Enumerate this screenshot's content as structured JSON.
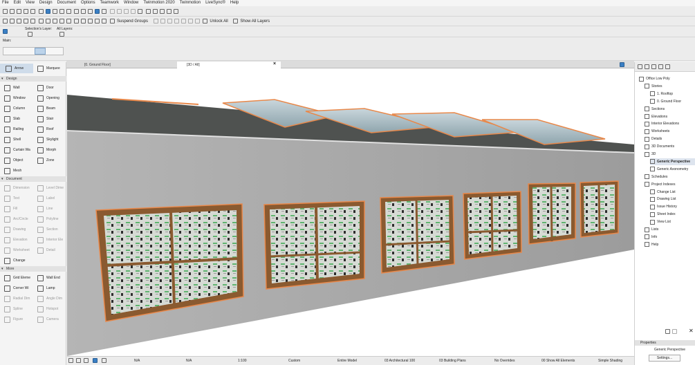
{
  "menu": [
    "File",
    "Edit",
    "View",
    "Design",
    "Document",
    "Options",
    "Teamwork",
    "Window",
    "Twinmotion 2020",
    "Twinmotion",
    "LiveSync®",
    "Help"
  ],
  "toolbar": {
    "suspend_groups": "Suspend Groups",
    "unlock_all": "Unlock All",
    "show_all_layers": "Show All Layers"
  },
  "infobox": {
    "selection_layer": "Selection's Layer:",
    "all_layers": "All Layers:",
    "main_label": "Main:"
  },
  "tabs": [
    {
      "label": "[0. Ground Floor]"
    },
    {
      "label": "[3D / All]"
    }
  ],
  "toolbox": {
    "arrow": "Arrow",
    "marquee": "Marquee",
    "sections": {
      "design": "Design",
      "document": "Document",
      "more": "More"
    },
    "design_tools": [
      "Wall",
      "Door",
      "Window",
      "Opening",
      "Column",
      "Beam",
      "Slab",
      "Stair",
      "Railing",
      "Roof",
      "Shell",
      "Skylight",
      "Curtain Wa",
      "Morph",
      "Object",
      "Zone",
      "Mesh"
    ],
    "document_tools": [
      "Dimension",
      "Level Dime",
      "Text",
      "Label",
      "Fill",
      "Line",
      "Arc/Circle",
      "Polyline",
      "Drawing",
      "Section",
      "Elevation",
      "Interior Ele",
      "Worksheet",
      "Detail",
      "Change"
    ],
    "more_tools": [
      "Grid Eleme",
      "Wall End",
      "Corner Wi",
      "Lamp",
      "Radial Dim",
      "Angle Dim",
      "Spline",
      "Hotspot",
      "Figure",
      "Camera"
    ]
  },
  "navigator": {
    "items": [
      {
        "label": "Office Low Poly",
        "level": 0
      },
      {
        "label": "Stories",
        "level": 1
      },
      {
        "label": "1. Rooftop",
        "level": 2
      },
      {
        "label": "0. Ground Floor",
        "level": 2
      },
      {
        "label": "Sections",
        "level": 1
      },
      {
        "label": "Elevations",
        "level": 1
      },
      {
        "label": "Interior Elevations",
        "level": 1
      },
      {
        "label": "Worksheets",
        "level": 1
      },
      {
        "label": "Details",
        "level": 1
      },
      {
        "label": "3D Documents",
        "level": 1
      },
      {
        "label": "3D",
        "level": 1
      },
      {
        "label": "Generic Perspective",
        "level": 2,
        "selected": true
      },
      {
        "label": "Generic Axonometry",
        "level": 2
      },
      {
        "label": "Schedules",
        "level": 1
      },
      {
        "label": "Project Indexes",
        "level": 1
      },
      {
        "label": "Change List",
        "level": 2
      },
      {
        "label": "Drawing List",
        "level": 2
      },
      {
        "label": "Issue History",
        "level": 2
      },
      {
        "label": "Sheet Index",
        "level": 2
      },
      {
        "label": "View List",
        "level": 2
      },
      {
        "label": "Lists",
        "level": 1
      },
      {
        "label": "Info",
        "level": 1
      },
      {
        "label": "Help",
        "level": 1
      }
    ],
    "properties_label": "Properties",
    "properties_value": "Generic Perspective",
    "settings_button": "Settings..."
  },
  "statusbar": {
    "na1": "N/A",
    "na2": "N/A",
    "scale": "1:100",
    "custom": "Custom",
    "model": "Entire Model",
    "pen": "03 Architectural 100",
    "mvo": "03 Building Plans",
    "overrides": "No Overrides",
    "renovation": "00 Show All Elements",
    "shading": "Simple Shading"
  },
  "colors": {
    "accent": "#3a7fc4",
    "highlight": "#e8884a",
    "wall": "#a8a8a8",
    "roof": "#4f5250"
  }
}
